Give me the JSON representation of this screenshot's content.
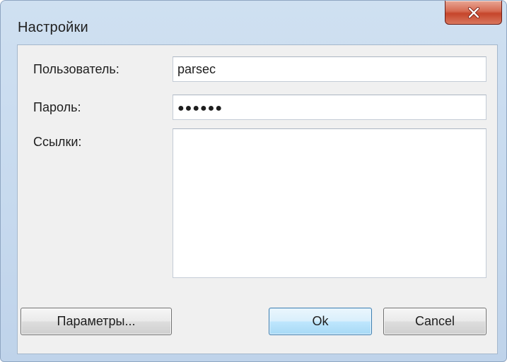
{
  "window": {
    "title": "Настройки",
    "close_label": "x"
  },
  "form": {
    "user_label": "Пользователь:",
    "user_value": "parsec",
    "password_label": "Пароль:",
    "password_mask": "●●●●●●",
    "links_label": "Ссылки:",
    "links_value": ""
  },
  "buttons": {
    "params_label": "Параметры...",
    "ok_label": "Ok",
    "cancel_label": "Cancel"
  }
}
